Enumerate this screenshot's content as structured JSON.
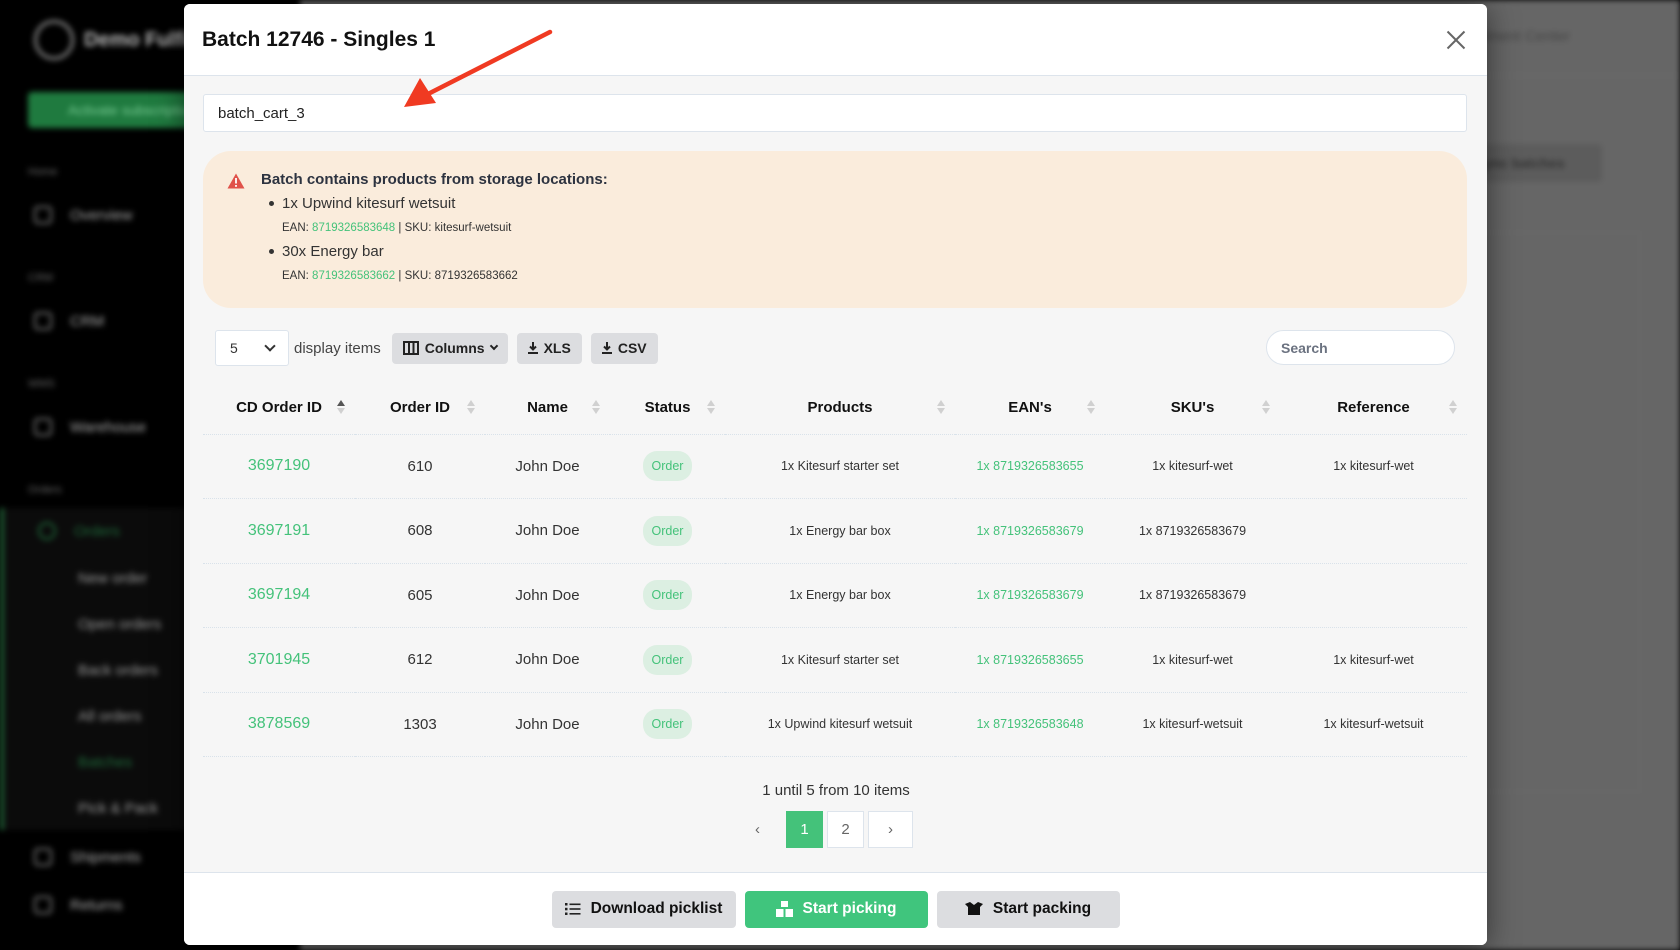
{
  "background": {
    "logo_text": "Demo Fulfilment",
    "activate_label": "Activate subscription",
    "sections": [
      "Home",
      "CRM",
      "WMS",
      "Orders"
    ],
    "nav": [
      "Overview",
      "CRM",
      "Warehouse",
      "Orders"
    ],
    "orders_sub": [
      "New order",
      "Open orders",
      "Back orders",
      "All orders",
      "Batches",
      "Pick & Pack"
    ],
    "nav_bottom": [
      "Shipments",
      "Returns"
    ],
    "topbar_right": "Fulfilment Center",
    "resync_label": "Resync batches"
  },
  "modal": {
    "title": "Batch 12746 - Singles 1",
    "cart_input_value": "batch_cart_3",
    "alert": {
      "title": "Batch contains products from storage locations:",
      "items": [
        {
          "product": "1x Upwind kitesurf wetsuit",
          "ean_label": "EAN:",
          "ean": "8719326583648",
          "sku_label": "| SKU:",
          "sku": "kitesurf-wetsuit"
        },
        {
          "product": "30x Energy bar",
          "ean_label": "EAN:",
          "ean": "8719326583662",
          "sku_label": "| SKU:",
          "sku": "8719326583662"
        }
      ]
    },
    "toolbar": {
      "page_size": "5",
      "display_label": "display items",
      "columns_label": "Columns",
      "xls_label": "XLS",
      "csv_label": "CSV",
      "search_placeholder": "Search"
    },
    "table": {
      "columns": [
        "CD Order ID",
        "Order ID",
        "Name",
        "Status",
        "Products",
        "EAN's",
        "SKU's",
        "Reference"
      ],
      "rows": [
        {
          "cd_order_id": "3697190",
          "order_id": "610",
          "name": "John Doe",
          "status": "Order",
          "products": "1x Kitesurf starter set",
          "eans": "1x 8719326583655",
          "skus": "1x kitesurf-wet",
          "reference": "1x kitesurf-wet"
        },
        {
          "cd_order_id": "3697191",
          "order_id": "608",
          "name": "John Doe",
          "status": "Order",
          "products": "1x Energy bar box",
          "eans": "1x 8719326583679",
          "skus": "1x 8719326583679",
          "reference": ""
        },
        {
          "cd_order_id": "3697194",
          "order_id": "605",
          "name": "John Doe",
          "status": "Order",
          "products": "1x Energy bar box",
          "eans": "1x 8719326583679",
          "skus": "1x 8719326583679",
          "reference": ""
        },
        {
          "cd_order_id": "3701945",
          "order_id": "612",
          "name": "John Doe",
          "status": "Order",
          "products": "1x Kitesurf starter set",
          "eans": "1x 8719326583655",
          "skus": "1x kitesurf-wet",
          "reference": "1x kitesurf-wet"
        },
        {
          "cd_order_id": "3878569",
          "order_id": "1303",
          "name": "John Doe",
          "status": "Order",
          "products": "1x Upwind kitesurf wetsuit",
          "eans": "1x 8719326583648",
          "skus": "1x kitesurf-wetsuit",
          "reference": "1x kitesurf-wetsuit"
        }
      ]
    },
    "pagination": {
      "info": "1 until 5 from 10 items",
      "prev": "‹",
      "pages": [
        "1",
        "2"
      ],
      "current": "1",
      "next": "›"
    },
    "footer": {
      "download_label": "Download picklist",
      "picking_label": "Start picking",
      "packing_label": "Start packing"
    }
  },
  "colors": {
    "accent": "#40c57d",
    "link": "#44c27a",
    "alert_bg": "#faecdc",
    "alert_icon": "#e0524a",
    "arrow": "#f03a22"
  }
}
